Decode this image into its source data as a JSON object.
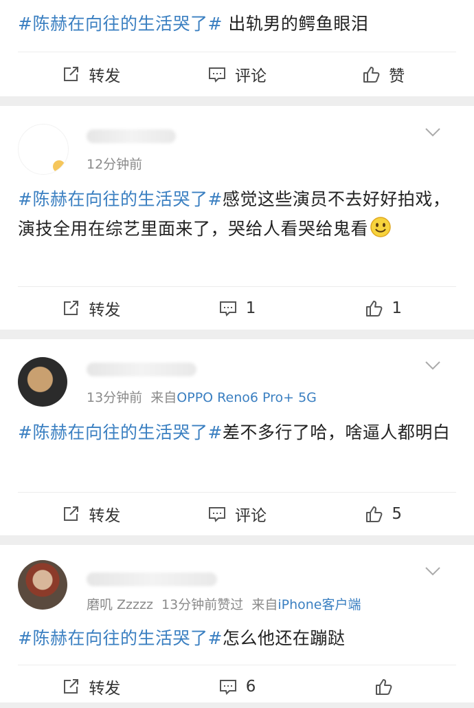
{
  "posts": [
    {
      "hashtag": "#陈赫在向往的生活哭了#",
      "text": " 出轨男的鳄鱼眼泪",
      "actions": {
        "repost": "转发",
        "comment": "评论",
        "like": "赞"
      }
    },
    {
      "time": "12分钟前",
      "hashtag": "#陈赫在向往的生活哭了#",
      "text": "感觉这些演员不去好好拍戏，演技全用在综艺里面来了，哭给人看哭给鬼看",
      "actions": {
        "repost": "转发",
        "comment": "1",
        "like": "1"
      }
    },
    {
      "time": "13分钟前",
      "source_prefix": "来自",
      "source": "OPPO Reno6 Pro+ 5G",
      "hashtag": "#陈赫在向往的生活哭了#",
      "text": "差不多行了哈，啥逼人都明白",
      "actions": {
        "repost": "转发",
        "comment": "评论",
        "like": "5"
      }
    },
    {
      "liked_by": "磨叽 Zzzzz",
      "time": "13分钟前赞过",
      "source_prefix": "来自",
      "source": "iPhone客户端",
      "hashtag": "#陈赫在向往的生活哭了#",
      "text": "怎么他还在蹦跶",
      "actions": {
        "repost": "转发",
        "comment": "6"
      }
    }
  ],
  "icons": [
    "repost-icon",
    "comment-icon",
    "like-icon",
    "chevron-down-icon",
    "smile-emoji"
  ],
  "colors": {
    "hashtag": "#3a7fc1",
    "meta": "#8a8a8a",
    "background": "#eeeeee"
  }
}
